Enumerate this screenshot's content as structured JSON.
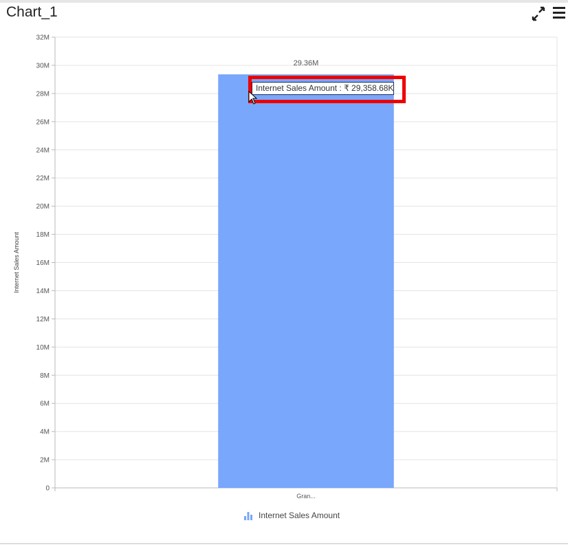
{
  "widget": {
    "title": "Chart_1"
  },
  "toolbar": {
    "expand_icon": "expand-icon",
    "menu_icon": "hamburger-menu-icon"
  },
  "colors": {
    "bar": "#78a7fb",
    "grid": "#e3e3e3",
    "axis": "#b8b8b8",
    "highlight": "#ee0000"
  },
  "chart_data": {
    "type": "bar",
    "categories": [
      "Gran..."
    ],
    "series": [
      {
        "name": "Internet Sales Amount",
        "values": [
          29358680
        ]
      }
    ],
    "ylabel": "Internet Sales Amount",
    "xlabel": "",
    "ylim": [
      0,
      32000000
    ],
    "yticks": [
      "0",
      "2M",
      "4M",
      "6M",
      "8M",
      "10M",
      "12M",
      "14M",
      "16M",
      "18M",
      "20M",
      "22M",
      "24M",
      "26M",
      "28M",
      "30M",
      "32M"
    ],
    "data_labels": [
      "29.36M"
    ],
    "grid": true,
    "legend": "bottom-center"
  },
  "tooltip": {
    "text": "Internet Sales Amount : ₹ 29,358.68K"
  },
  "legend": {
    "label": "Internet Sales Amount"
  }
}
